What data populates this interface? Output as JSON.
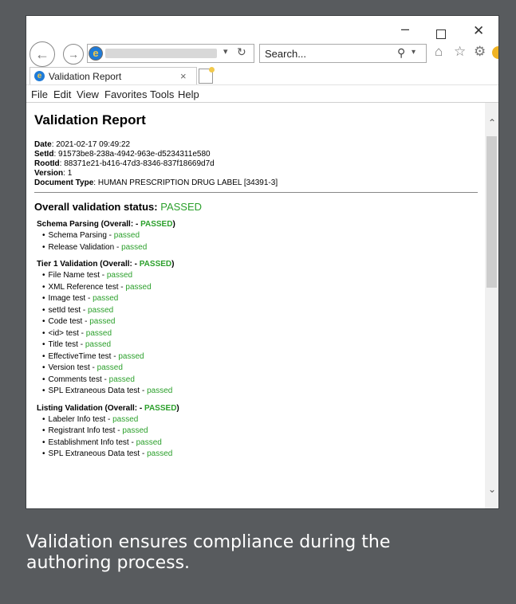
{
  "browser": {
    "search_placeholder": "Search...",
    "tab_label": "Validation Report",
    "menu": [
      "File",
      "Edit",
      "View",
      "Favorites",
      "Tools",
      "Help"
    ]
  },
  "report": {
    "title": "Validation Report",
    "meta": [
      {
        "label": "Date",
        "value": "2021-02-17 09:49:22"
      },
      {
        "label": "SetId",
        "value": "91573be8-238a-4942-963e-d5234311e580"
      },
      {
        "label": "RootId",
        "value": "88371e21-b416-47d3-8346-837f18669d7d"
      },
      {
        "label": "Version",
        "value": "1"
      },
      {
        "label": "Document Type",
        "value": "HUMAN PRESCRIPTION DRUG LABEL [34391-3]"
      }
    ],
    "overall_label": "Overall validation status:",
    "overall_status": "PASSED",
    "status_color": "#2ca02c",
    "sections": [
      {
        "title": "Schema Parsing (Overall: -",
        "status": "PASSED",
        "items": [
          {
            "name": "Schema Parsing",
            "result": "passed"
          },
          {
            "name": "Release Validation",
            "result": "passed"
          }
        ]
      },
      {
        "title": "Tier 1 Validation (Overall: -",
        "status": "PASSED",
        "items": [
          {
            "name": "File Name test",
            "result": "passed"
          },
          {
            "name": "XML Reference test",
            "result": "passed"
          },
          {
            "name": "Image test",
            "result": "passed"
          },
          {
            "name": "setId test",
            "result": "passed"
          },
          {
            "name": "Code test",
            "result": "passed"
          },
          {
            "name": "<id> test",
            "result": "passed"
          },
          {
            "name": "Title test",
            "result": "passed"
          },
          {
            "name": "EffectiveTime test",
            "result": "passed"
          },
          {
            "name": "Version test",
            "result": "passed"
          },
          {
            "name": "Comments test",
            "result": "passed"
          },
          {
            "name": "SPL Extraneous Data test",
            "result": "passed"
          }
        ]
      },
      {
        "title": "Listing Validation (Overall: -",
        "status": "PASSED",
        "items": [
          {
            "name": "Labeler Info test",
            "result": "passed"
          },
          {
            "name": "Registrant Info test",
            "result": "passed"
          },
          {
            "name": "Establishment Info test",
            "result": "passed"
          },
          {
            "name": "SPL Extraneous Data test",
            "result": "passed"
          }
        ]
      }
    ]
  },
  "caption": "Validation ensures compliance during the authoring process."
}
